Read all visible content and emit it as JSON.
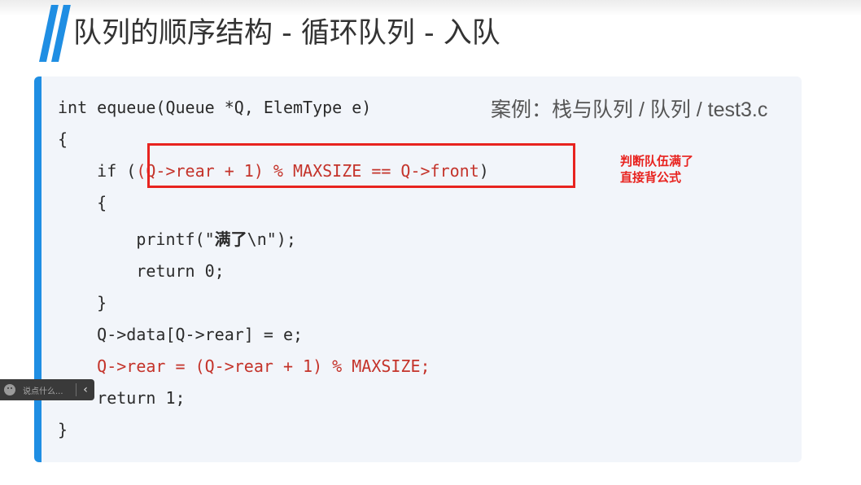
{
  "slide": {
    "title": "队列的顺序结构 - 循环队列 - 入队",
    "case_label": "案例：栈与队列 / 队列 / test3.c"
  },
  "code": {
    "lines": [
      "int equeue(Queue *Q, ElemType e)",
      "{",
      "    if (",
      "    {",
      "        printf(\"满了\\n\");",
      "        return 0;",
      "    }",
      "    Q->data[Q->rear] = e;",
      "    Q->rear = (Q->rear + 1) % MAXSIZE;",
      "    return 1;",
      "}"
    ],
    "if_condition": "(Q->rear + 1) % MAXSIZE == Q->front",
    "if_close": ")",
    "printf_prefix": "printf(\"",
    "printf_cn": "满了",
    "printf_suffix": "\\n\");"
  },
  "annotation": {
    "line1": "判断队伍满了",
    "line2": "直接背公式",
    "color": "#e8231f"
  },
  "danmaku": {
    "placeholder": "说点什么...",
    "toggle_glyph": "‹"
  },
  "colors": {
    "accent": "#1f8ee3",
    "code_red": "#c4332a",
    "panel_bg": "#f2f5fa"
  },
  "icons": {
    "title_mark": "double-slash-mark-icon",
    "danmaku": "danmaku-face-icon",
    "toggle": "chevron-left-icon"
  }
}
